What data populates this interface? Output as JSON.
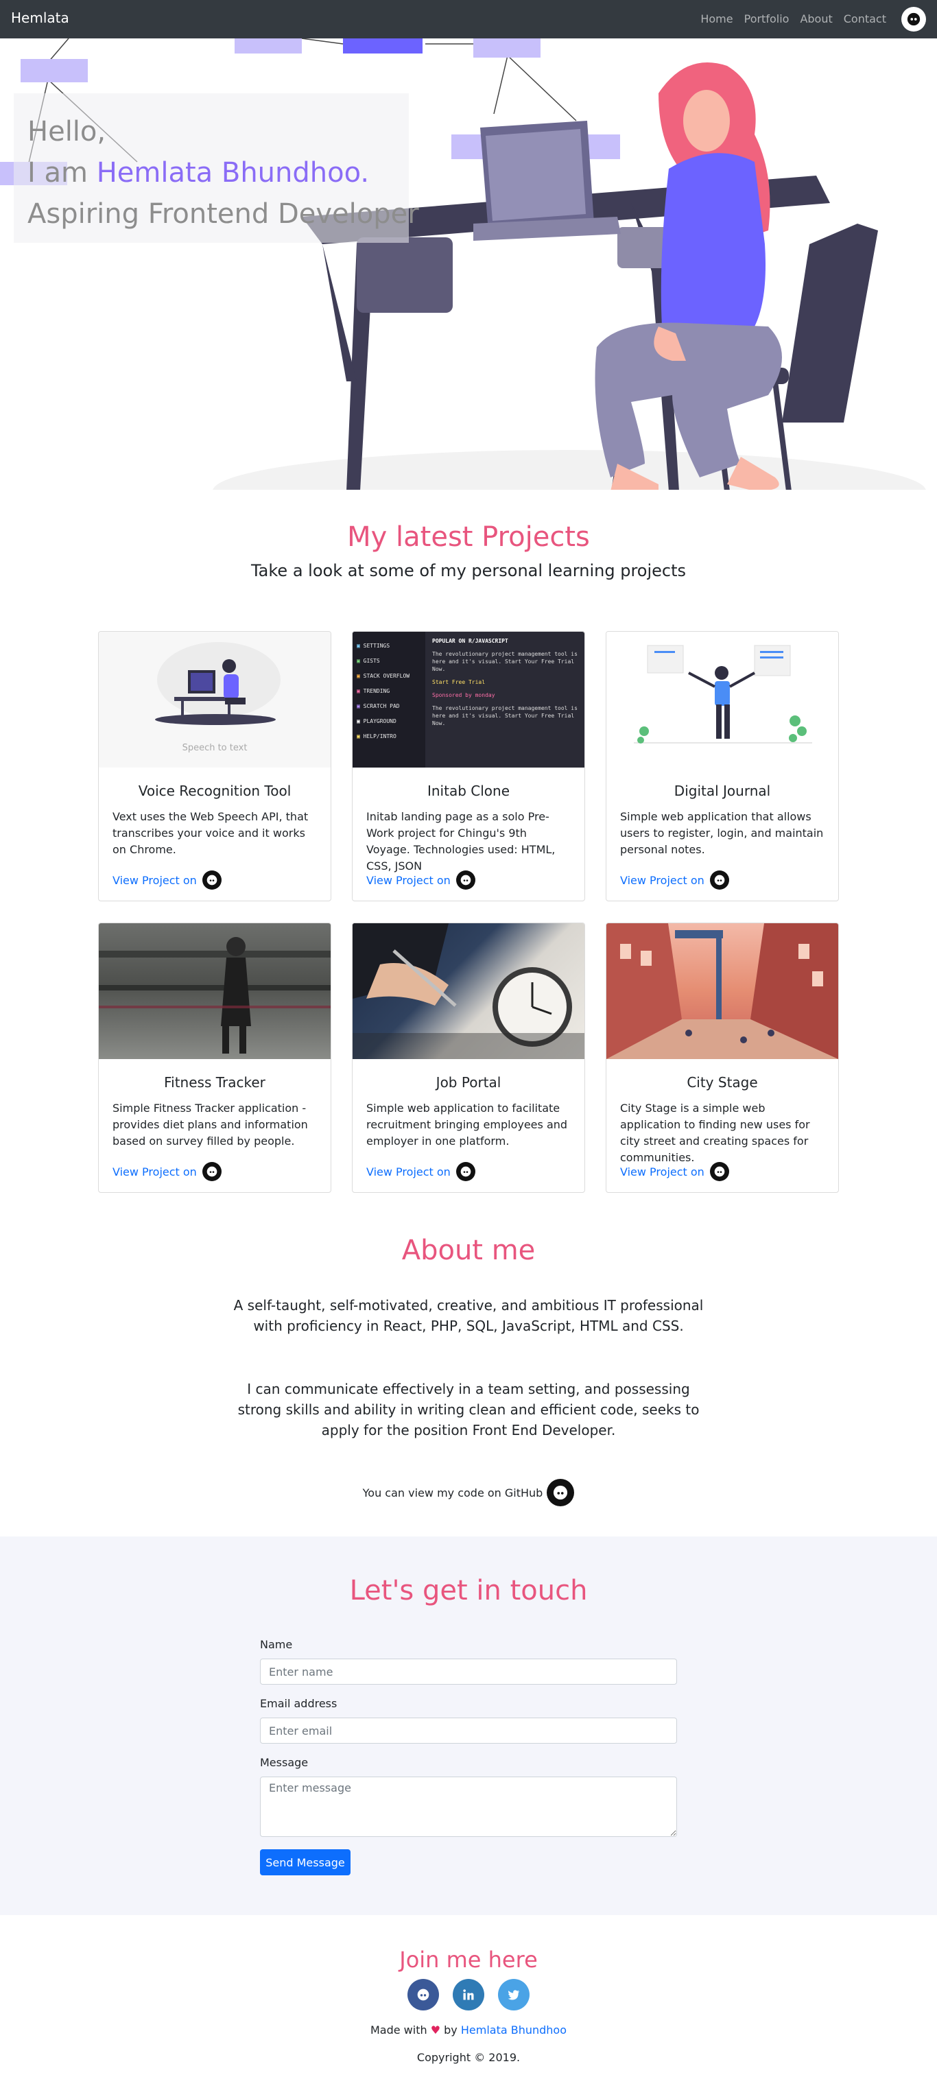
{
  "nav": {
    "brand": "Hemlata",
    "links": [
      "Home",
      "Portfolio",
      "About",
      "Contact"
    ]
  },
  "hero": {
    "line1": "Hello,",
    "line2_prefix": "I am ",
    "name": "Hemlata Bhundhoo.",
    "line3": "Aspiring Frontend Developer"
  },
  "projects": {
    "title": "My latest Projects",
    "subtitle": "Take a look at some of my personal learning projects",
    "link_label": "View Project on",
    "items": [
      {
        "title": "Voice Recognition Tool",
        "text": "Vext uses the Web Speech API, that transcribes your voice and it works on Chrome.",
        "image_caption": "Speech to text"
      },
      {
        "title": "Initab Clone",
        "text": "Initab landing page as a solo Pre-Work project for Chingu's 9th Voyage. Technologies used: HTML, CSS, JSON"
      },
      {
        "title": "Digital Journal",
        "text": "Simple web application that allows users to register, login, and maintain personal notes."
      },
      {
        "title": "Fitness Tracker",
        "text": "Simple Fitness Tracker application - provides diet plans and information based on survey filled by people."
      },
      {
        "title": "Job Portal",
        "text": "Simple web application to facilitate recruitment bringing employees and employer in one platform."
      },
      {
        "title": "City Stage",
        "text": "City Stage is a simple web application to finding new uses for city street and creating spaces for communities."
      }
    ],
    "initab_menu": [
      "SETTINGS",
      "GISTS",
      "STACK OVERFLOW",
      "TRENDING",
      "SCRATCH PAD",
      "PLAYGROUND",
      "HELP/INTRO"
    ],
    "initab_header": "POPULAR ON R/JAVASCRIPT",
    "initab_body": "The revolutionary project management tool is here and it's visual. Start Your Free Trial Now.",
    "initab_cta": "Start Free Trial",
    "initab_sponsor": "Sponsored by monday"
  },
  "about": {
    "title": "About me",
    "p1": "A self-taught, self-motivated, creative, and ambitious IT professional with proficiency in React, PHP, SQL, JavaScript, HTML and CSS.",
    "p2": "I can communicate effectively in a team setting, and possessing strong skills and ability in writing clean and efficient code, seeks to apply for the position Front End Developer.",
    "github_line": "You can view my code on GitHub"
  },
  "contact": {
    "title": "Let's get in touch",
    "name_label": "Name",
    "name_placeholder": "Enter name",
    "email_label": "Email address",
    "email_placeholder": "Enter email",
    "message_label": "Message",
    "message_placeholder": "Enter message",
    "button": "Send Message"
  },
  "footer": {
    "join": "Join me here",
    "made_prefix": "Made with",
    "made_by": "by",
    "author": "Hemlata Bhundhoo",
    "copyright": "Copyright © 2019."
  },
  "colors": {
    "accent_pink": "#e8557e",
    "accent_purple": "#6c63ff",
    "link_blue": "#0d6efd",
    "navbar": "#343a40",
    "github": "#3b5998",
    "linkedin": "#2f7bb5",
    "twitter": "#4aa3e6"
  }
}
